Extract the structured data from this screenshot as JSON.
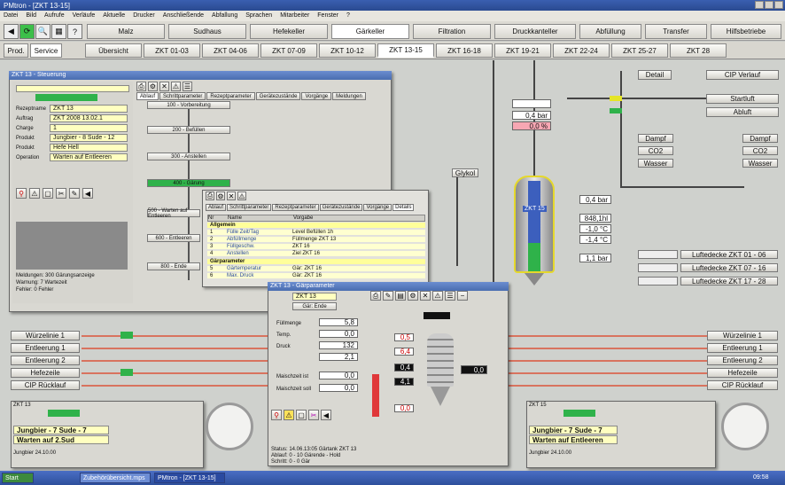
{
  "window": {
    "title": "PMtron - [ZKT 13-15]"
  },
  "menu": [
    "Datei",
    "Bild",
    "Aufrufe",
    "Verläufe",
    "Aktuelle",
    "Drucker",
    "Anschließende",
    "Abfallung",
    "Sprachen",
    "Mitarbeiter",
    "Fenster",
    "?"
  ],
  "areas": [
    "Malz",
    "Sudhaus",
    "Hefekeller",
    "Gärkeller",
    "Filtration",
    "Druckkanteller",
    "Abfüllung",
    "Transfer",
    "Hilfsbetriebe"
  ],
  "tabs": {
    "left": [
      "Prod.",
      "Service"
    ],
    "items": [
      "Übersicht",
      "ZKT 01-03",
      "ZKT 04-06",
      "ZKT 07-09",
      "ZKT 10-12",
      "ZKT 13-15",
      "ZKT 16-18",
      "ZKT 19-21",
      "ZKT 22-24",
      "ZKT 25-27",
      "ZKT 28"
    ]
  },
  "process": {
    "detail": "Detail",
    "cip_verlauf": "CIP Verlauf",
    "startluft": "Startluft",
    "abluft": "Abluft",
    "pressure_main": "0,4 bar",
    "percent_main": "0,0 %",
    "media_left": [
      "Dampf",
      "CO2",
      "Wasser"
    ],
    "media_right": [
      "Dampf",
      "CO2",
      "Wasser"
    ],
    "glykol": "Glykol",
    "tank_label": "ZKT 15",
    "tank_values": [
      "0,4 bar",
      "848,1hl",
      "-1,0 °C",
      "-1,4 °C",
      "1,1 bar"
    ],
    "luftedecke": [
      "Luftedecke ZKT 01 - 06",
      "Luftedecke ZKT 07 - 16",
      "Luftedecke ZKT 17 - 28"
    ],
    "lines_left": [
      "Würzelinie 1",
      "Entleerung 1",
      "Entleerung 2",
      "Hefezeile",
      "CIP Rücklauf"
    ],
    "lines_right": [
      "Würzelinie 1",
      "Entleerung 1",
      "Entleerung 2",
      "Hefezeile",
      "CIP Rücklauf"
    ]
  },
  "bottom_left": {
    "header": "ZKT 13",
    "line1": "Jungbier - 7 Sude - 7",
    "line2": "Warten auf 2.Sud",
    "footer": "Jungbier 24.10.00"
  },
  "bottom_right": {
    "header": "ZKT 15",
    "line1": "Jungbier - 7 Sude - 7",
    "line2": "Warten auf Entleeren",
    "footer": "Jungbier 24.10.00"
  },
  "panel1": {
    "title": "ZKT 13 - Steuerung",
    "tabs": [
      "Ablauf",
      "Schrittparameter",
      "Rezeptparameter",
      "Gerätezustände",
      "Vorgänge",
      "Meldungen"
    ],
    "fields": [
      "Rezeptname",
      "Auftrag",
      "Charge",
      "Produkt",
      "Produkt",
      "Operation"
    ],
    "values": [
      "ZKT 13",
      "ZKT 2008 13.02.1",
      "1",
      "Jungbier - 8 Sude - 12",
      "Hefe Hell",
      "Warten auf Entleeren"
    ],
    "steps": [
      "100 - Vorbereitung",
      "200 - Befüllen",
      "300 - Anstellen",
      "400 - Gärung",
      "500 - Warten auf Entleeren",
      "600 - Entleeren",
      "700 - Reinigen",
      "800 - Ende"
    ],
    "footer": [
      "Meldungen: 300 Gärungsanzeige",
      "Warnung: 7 Wartezeit",
      "Fehler: 0 Fehler"
    ]
  },
  "panel2": {
    "tabs": [
      "Ablauf",
      "Schrittparameter",
      "Rezeptparameter",
      "Gerätezustände",
      "Vorgänge",
      "Details"
    ],
    "cols": [
      "Nr",
      "Name",
      "Vorgabe"
    ],
    "group1": "Allgemein",
    "rows1": [
      [
        "1",
        "Fülle Zeit/Tag",
        "Level Befüllen 1h"
      ],
      [
        "2",
        "Abfüllmenge",
        "Füllmenge ZKT 13"
      ],
      [
        "3",
        "Füllgeschw.",
        "ZKT 16"
      ],
      [
        "4",
        "Anstellen",
        "Ziel ZKT 16"
      ]
    ],
    "group2": "Gärparameter",
    "rows2": [
      [
        "5",
        "Gärtemperatur",
        "Gär: ZKT 16"
      ],
      [
        "6",
        "Max. Druck",
        "Gär: ZKT 16"
      ]
    ]
  },
  "panel3": {
    "title": "ZKT 13 - Gärparameter",
    "field_head": "ZKT 13",
    "sub_head": "Gär: Ende",
    "labels": [
      "Füllmenge",
      "Temp.",
      "Druck",
      "Ist/Soll",
      "Zeit",
      "Maischzeit ist",
      "Maischzeit soll"
    ],
    "values": [
      "5,8",
      "0,0",
      "132",
      "2,1",
      "",
      "0,0",
      "0,0"
    ],
    "tank_values": [
      "0,5",
      "6,4",
      "0,4",
      "4,1",
      "0,0"
    ],
    "right_value": "0,0",
    "footer": [
      "Status: 14.06.13:05 Gärtank ZKT 13",
      "Ablauf: 0 - 10 Gärende - Hold",
      "Schritt: 0 - 0 Gär"
    ]
  },
  "taskbar": {
    "start": "Start",
    "items": [
      "Zubehörübersicht.mps",
      "PMtron - [ZKT 13-15]"
    ],
    "clock": "09:58"
  }
}
